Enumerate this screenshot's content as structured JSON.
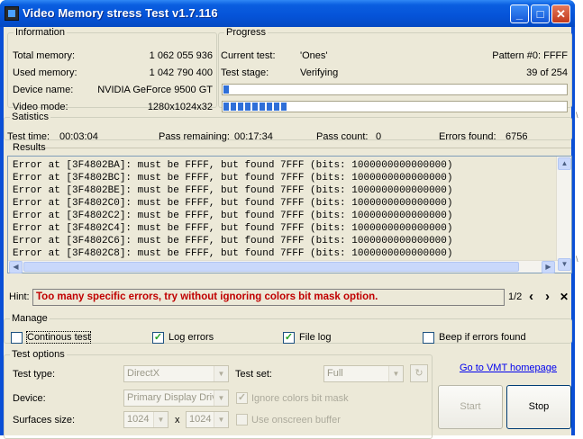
{
  "window": {
    "title": "Video Memory stress Test v1.7.116",
    "controls": {
      "minimize": "_",
      "maximize": "□",
      "close": "✕"
    }
  },
  "information": {
    "legend": "Information",
    "rows": [
      {
        "label": "Total memory:",
        "value": "1 062 055 936"
      },
      {
        "label": "Used memory:",
        "value": "1 042 790 400"
      },
      {
        "label": "Device name:",
        "value": "NVIDIA GeForce 9500 GT"
      },
      {
        "label": "Video mode:",
        "value": "1280x1024x32"
      }
    ]
  },
  "progress": {
    "legend": "Progress",
    "current_test_label": "Current test:",
    "current_test_value": "'Ones'",
    "pattern": "Pattern #0: FFFF",
    "stage_label": "Test stage:",
    "stage_value": "Verifying",
    "stage_count": "39 of 254",
    "bar1_fraction": 0.012,
    "bar2_fraction": 0.18
  },
  "statistics": {
    "legend": "Satistics",
    "test_time_label": "Test time:",
    "test_time_value": "00:03:04",
    "pass_remaining_label": "Pass remaining:",
    "pass_remaining_value": "00:17:34",
    "pass_count_label": "Pass count:",
    "pass_count_value": "0",
    "errors_label": "Errors found:",
    "errors_value": "6756"
  },
  "results": {
    "legend": "Results",
    "lines": [
      "Error at [3F4802BA]: must be FFFF, but found 7FFF (bits: 1000000000000000)",
      "Error at [3F4802BC]: must be FFFF, but found 7FFF (bits: 1000000000000000)",
      "Error at [3F4802BE]: must be FFFF, but found 7FFF (bits: 1000000000000000)",
      "Error at [3F4802C0]: must be FFFF, but found 7FFF (bits: 1000000000000000)",
      "Error at [3F4802C2]: must be FFFF, but found 7FFF (bits: 1000000000000000)",
      "Error at [3F4802C4]: must be FFFF, but found 7FFF (bits: 1000000000000000)",
      "Error at [3F4802C6]: must be FFFF, but found 7FFF (bits: 1000000000000000)",
      "Error at [3F4802C8]: must be FFFF, but found 7FFF (bits: 1000000000000000)"
    ]
  },
  "hint": {
    "label": "Hint:",
    "text": "Too many specific errors, try without ignoring colors bit mask option.",
    "page": "1/2",
    "prev": "‹",
    "next": "›",
    "close": "✕"
  },
  "manage": {
    "legend": "Manage",
    "continuous_test": {
      "label": "Continous test",
      "checked": false
    },
    "log_errors": {
      "label": "Log errors",
      "checked": true
    },
    "file_log": {
      "label": "File log",
      "checked": true
    },
    "beep": {
      "label": "Beep if errors found",
      "checked": false
    }
  },
  "test_options": {
    "legend": "Test options",
    "test_type_label": "Test type:",
    "test_type_value": "DirectX",
    "test_set_label": "Test set:",
    "test_set_value": "Full",
    "device_label": "Device:",
    "device_value": "Primary Display Drive",
    "ignore_colors_label": "Ignore colors bit mask",
    "surfaces_label": "Surfaces size:",
    "surface_w": "1024",
    "surface_x": "x",
    "surface_h": "1024",
    "onscreen_label": "Use onscreen buffer"
  },
  "actions": {
    "homepage_link": "Go to VMT homepage",
    "start": "Start",
    "stop": "Stop"
  },
  "colors": {
    "title_bar": "#0553d8",
    "hint_text": "#c00000",
    "progress_fill": "#2f6fd8",
    "client_bg": "#ece9d8"
  }
}
